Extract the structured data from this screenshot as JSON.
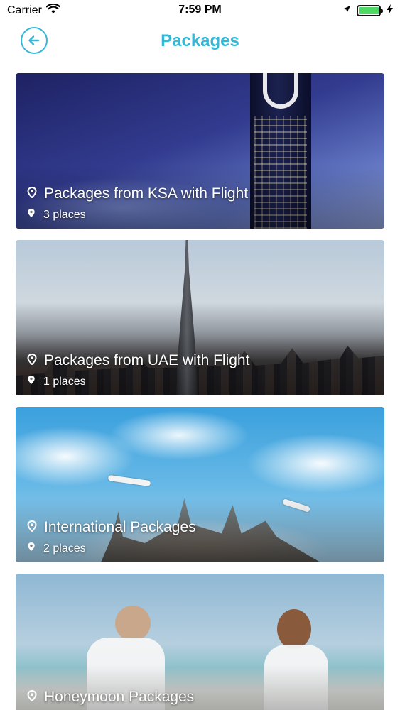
{
  "status_bar": {
    "carrier": "Carrier",
    "time": "7:59 PM",
    "battery_level_percent": 100
  },
  "nav": {
    "title": "Packages"
  },
  "packages": [
    {
      "title": "Packages from KSA with Flight",
      "count": "3 places"
    },
    {
      "title": "Packages from UAE with Flight",
      "count": "1 places"
    },
    {
      "title": "International Packages",
      "count": "2 places"
    },
    {
      "title": "Honeymoon Packages",
      "count": ""
    }
  ],
  "colors": {
    "accent": "#35b7d6",
    "battery": "#4cd964"
  },
  "icons": {
    "back": "arrow-left-icon",
    "location": "location-pin-icon"
  }
}
